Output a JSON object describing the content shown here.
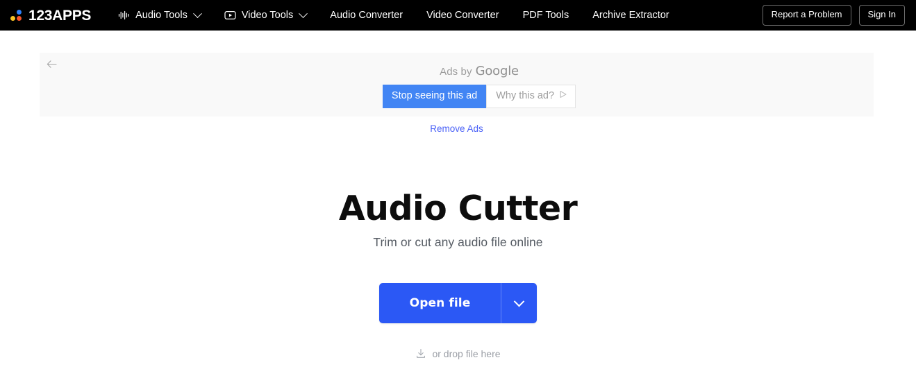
{
  "header": {
    "logo": {
      "text": "123APPS",
      "dot_colors": {
        "blue": "#2d7ff9",
        "yellow": "#f5c225",
        "orange": "#f5562a"
      }
    },
    "nav": [
      {
        "label": "Audio Tools",
        "icon": "waveform-icon",
        "has_chevron": true
      },
      {
        "label": "Video Tools",
        "icon": "play-square-icon",
        "has_chevron": true
      },
      {
        "label": "Audio Converter",
        "icon": null,
        "has_chevron": false
      },
      {
        "label": "Video Converter",
        "icon": null,
        "has_chevron": false
      },
      {
        "label": "PDF Tools",
        "icon": null,
        "has_chevron": false
      },
      {
        "label": "Archive Extractor",
        "icon": null,
        "has_chevron": false
      }
    ],
    "report_button": "Report a Problem",
    "signin_button": "Sign In",
    "background": "#000000"
  },
  "ad": {
    "back_icon": "back-arrow-icon",
    "ads_by_prefix": "Ads by",
    "ads_by_brand": "Google",
    "stop_button": "Stop seeing this ad",
    "why_button": "Why this ad?",
    "why_icon": "info-triangle-icon",
    "remove_ads_link": "Remove Ads",
    "stop_button_color": "#4285f4",
    "remove_ads_color": "#4a61f7",
    "background": "#f9f9f9"
  },
  "main": {
    "title": "Audio Cutter",
    "subtitle": "Trim or cut any audio file online",
    "open_file_label": "Open file",
    "open_file_caret_icon": "chevron-down-icon",
    "drop_hint": "or drop file here",
    "drop_icon": "download-tray-icon",
    "accent_color": "#2b58f5"
  }
}
